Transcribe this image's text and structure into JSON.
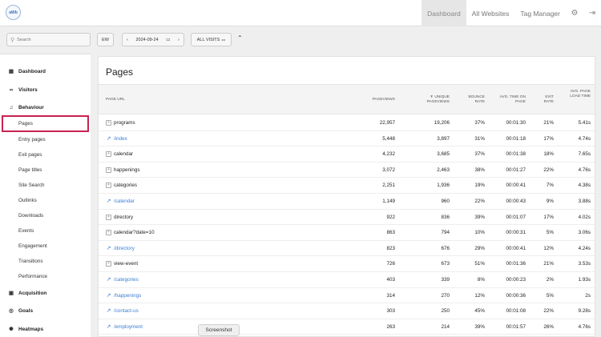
{
  "app": {
    "logo_text": "aWb"
  },
  "topnav": {
    "items": [
      {
        "label": "Dashboard"
      },
      {
        "label": "All Websites"
      },
      {
        "label": "Tag Manager"
      }
    ]
  },
  "toolbar": {
    "search_placeholder": "Search",
    "period": "EW",
    "date": "2024-09-24",
    "segment": "ALL VISITS"
  },
  "sidebar": {
    "items": [
      {
        "label": "Dashboard",
        "type": "cat",
        "icon": "dashboard-icon"
      },
      {
        "label": "Visitors",
        "type": "cat",
        "icon": "visitors-icon"
      },
      {
        "label": "Behaviour",
        "type": "cat",
        "icon": "bell-icon"
      },
      {
        "label": "Pages",
        "type": "sub",
        "selected": true
      },
      {
        "label": "Entry pages",
        "type": "sub"
      },
      {
        "label": "Exit pages",
        "type": "sub"
      },
      {
        "label": "Page titles",
        "type": "sub"
      },
      {
        "label": "Site Search",
        "type": "sub"
      },
      {
        "label": "Outlinks",
        "type": "sub"
      },
      {
        "label": "Downloads",
        "type": "sub"
      },
      {
        "label": "Events",
        "type": "sub"
      },
      {
        "label": "Engagement",
        "type": "sub"
      },
      {
        "label": "Transitions",
        "type": "sub"
      },
      {
        "label": "Performance",
        "type": "sub"
      },
      {
        "label": "Acquisition",
        "type": "cat",
        "icon": "acquisition-icon"
      },
      {
        "label": "Goals",
        "type": "cat",
        "icon": "goals-icon"
      },
      {
        "label": "Heatmaps",
        "type": "cat",
        "icon": "heatmaps-icon"
      }
    ]
  },
  "main": {
    "title": "Pages",
    "columns": [
      "PAGE URL",
      "PAGEVIEWS",
      "UNIQUE PAGEVIEWS",
      "BOUNCE RATE",
      "AVG. TIME ON PAGE",
      "EXIT RATE",
      "AVG. PAGE LOAD TIME"
    ],
    "rows": [
      {
        "url": "programs",
        "folder": true,
        "pv": "22,957",
        "upv": "19,206",
        "bounce": "37%",
        "time": "00:01:30",
        "exit": "21%",
        "load": "5.41s"
      },
      {
        "url": "/index",
        "folder": false,
        "pv": "5,448",
        "upv": "3,897",
        "bounce": "31%",
        "time": "00:01:18",
        "exit": "17%",
        "load": "4.74s"
      },
      {
        "url": "calendar",
        "folder": true,
        "pv": "4,232",
        "upv": "3,685",
        "bounce": "37%",
        "time": "00:01:38",
        "exit": "18%",
        "load": "7.65s"
      },
      {
        "url": "happenings",
        "folder": true,
        "pv": "3,072",
        "upv": "2,463",
        "bounce": "38%",
        "time": "00:01:27",
        "exit": "22%",
        "load": "4.76s"
      },
      {
        "url": "categories",
        "folder": true,
        "pv": "2,251",
        "upv": "1,936",
        "bounce": "19%",
        "time": "00:00:41",
        "exit": "7%",
        "load": "4.38s"
      },
      {
        "url": "/calendar",
        "folder": false,
        "pv": "1,149",
        "upv": "960",
        "bounce": "22%",
        "time": "00:00:43",
        "exit": "9%",
        "load": "3.88s"
      },
      {
        "url": "directory",
        "folder": true,
        "pv": "922",
        "upv": "836",
        "bounce": "39%",
        "time": "00:01:07",
        "exit": "17%",
        "load": "4.02s"
      },
      {
        "url": "calendar?date=10",
        "folder": true,
        "pv": "863",
        "upv": "794",
        "bounce": "10%",
        "time": "00:00:31",
        "exit": "5%",
        "load": "3.06s"
      },
      {
        "url": "/directory",
        "folder": false,
        "pv": "823",
        "upv": "676",
        "bounce": "29%",
        "time": "00:00:41",
        "exit": "12%",
        "load": "4.24s"
      },
      {
        "url": "view-event",
        "folder": true,
        "pv": "726",
        "upv": "673",
        "bounce": "51%",
        "time": "00:01:36",
        "exit": "21%",
        "load": "3.53s"
      },
      {
        "url": "/categories",
        "folder": false,
        "pv": "403",
        "upv": "339",
        "bounce": "8%",
        "time": "00:00:23",
        "exit": "2%",
        "load": "1.93s"
      },
      {
        "url": "/happenings",
        "folder": false,
        "pv": "314",
        "upv": "270",
        "bounce": "12%",
        "time": "00:00:36",
        "exit": "5%",
        "load": "2s"
      },
      {
        "url": "/contact-us",
        "folder": false,
        "pv": "303",
        "upv": "250",
        "bounce": "45%",
        "time": "00:01:08",
        "exit": "22%",
        "load": "9.28s"
      },
      {
        "url": "/employment",
        "folder": false,
        "pv": "263",
        "upv": "214",
        "bounce": "39%",
        "time": "00:01:57",
        "exit": "26%",
        "load": "4.76s"
      }
    ]
  },
  "tooltip": "Screenshot",
  "colors": {
    "selected_outline": "#c8234f",
    "link": "#3b7ed6"
  }
}
